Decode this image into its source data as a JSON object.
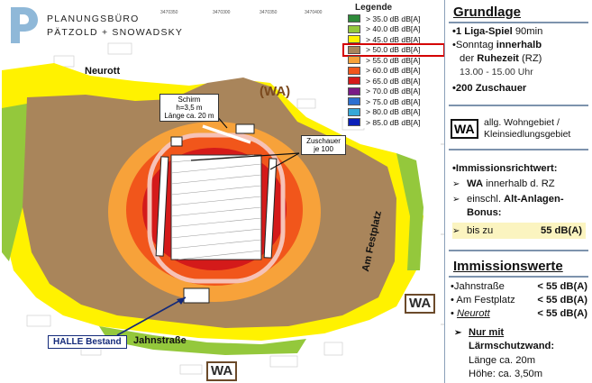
{
  "header": {
    "logo_line1": "PLANUNGSBÜRO",
    "logo_line2": "PÄTZOLD + SNOWADSKY"
  },
  "legend": {
    "title": "Legende",
    "highlighted_index": 3,
    "items": [
      {
        "label": "> 35.0 dB dB[A]",
        "color": "#2e8b3a"
      },
      {
        "label": "> 40.0 dB dB[A]",
        "color": "#94c83c"
      },
      {
        "label": "> 45.0 dB dB[A]",
        "color": "#fff200"
      },
      {
        "label": "> 50.0 dB dB[A]",
        "color": "#a9855b"
      },
      {
        "label": "> 55.0 dB dB[A]",
        "color": "#f7a23a"
      },
      {
        "label": "> 60.0 dB dB[A]",
        "color": "#f1561b"
      },
      {
        "label": "> 65.0 dB dB[A]",
        "color": "#d41a1a"
      },
      {
        "label": "> 70.0 dB dB[A]",
        "color": "#7a1a86"
      },
      {
        "label": "> 75.0 dB dB[A]",
        "color": "#2b6fd0"
      },
      {
        "label": "> 80.0 dB dB[A]",
        "color": "#35a8d8"
      },
      {
        "label": "> 85.0 dB dB[A]",
        "color": "#0a1fb8"
      }
    ]
  },
  "map": {
    "axis_numbers": [
      "3470350",
      "3470300",
      "3470350",
      "3470400"
    ],
    "street_neurott": "Neurott",
    "street_jahnstrasse": "Jahnstraße",
    "street_festplatz": "Am Festplatz",
    "wa_top": "(WA)",
    "wa_right": "WA",
    "wa_bottom": "WA",
    "schirm_lines": [
      "Schirm",
      "h=3,5 m",
      "Länge ca. 20 m"
    ],
    "zuschauer_lines": [
      "Zuschauer",
      "je 100"
    ],
    "halle": "HALLE Bestand",
    "colors": {
      "green": "#94c83c",
      "yellow": "#fff200",
      "brown": "#a9855b",
      "light_orange": "#f7a23a",
      "orange": "#f1561b",
      "red": "#d41a1a",
      "arrow_blue": "#13297a"
    }
  },
  "grundlage": {
    "title": "Grundlage",
    "line1_a": "•1 Liga-Spiel",
    "line1_b": " 90min",
    "line2_a": "•Sonntag ",
    "line2_b": "innerhalb",
    "line3_a": "der ",
    "line3_b": "Ruhezeit",
    "line3_c": " (RZ)",
    "line4": "13.00 - 15.00 Uhr",
    "line5": "•200 Zuschauer"
  },
  "wa_legend": {
    "box": "WA",
    "line1": "allg. Wohngebiet /",
    "line2": "Kleinsiedlungsgebiet"
  },
  "richtwert": {
    "title": "•Immissionsrichtwert:",
    "line1_a": "WA",
    "line1_b": " innerhalb d. RZ",
    "line2_a": "einschl. ",
    "line2_b": "Alt-Anlagen-",
    "line3": "Bonus:",
    "line4_a": "bis zu",
    "line4_b": "55 dB(A)"
  },
  "immission": {
    "title": "Immissionswerte",
    "rows": [
      {
        "label": "•Jahnstraße",
        "value": "< 55 dB(A)"
      },
      {
        "label": "• Am Festplatz",
        "value": "< 55 dB(A)"
      },
      {
        "label_prefix": "• ",
        "label": "Neurott",
        "value": "< 55 dB(A)"
      }
    ],
    "nur_mit_a": "Nur mit",
    "nur_mit_b": "Lärmschutzwand:",
    "laenge": "Länge ca. 20m",
    "hoehe": "Höhe: ca. 3,50m"
  }
}
